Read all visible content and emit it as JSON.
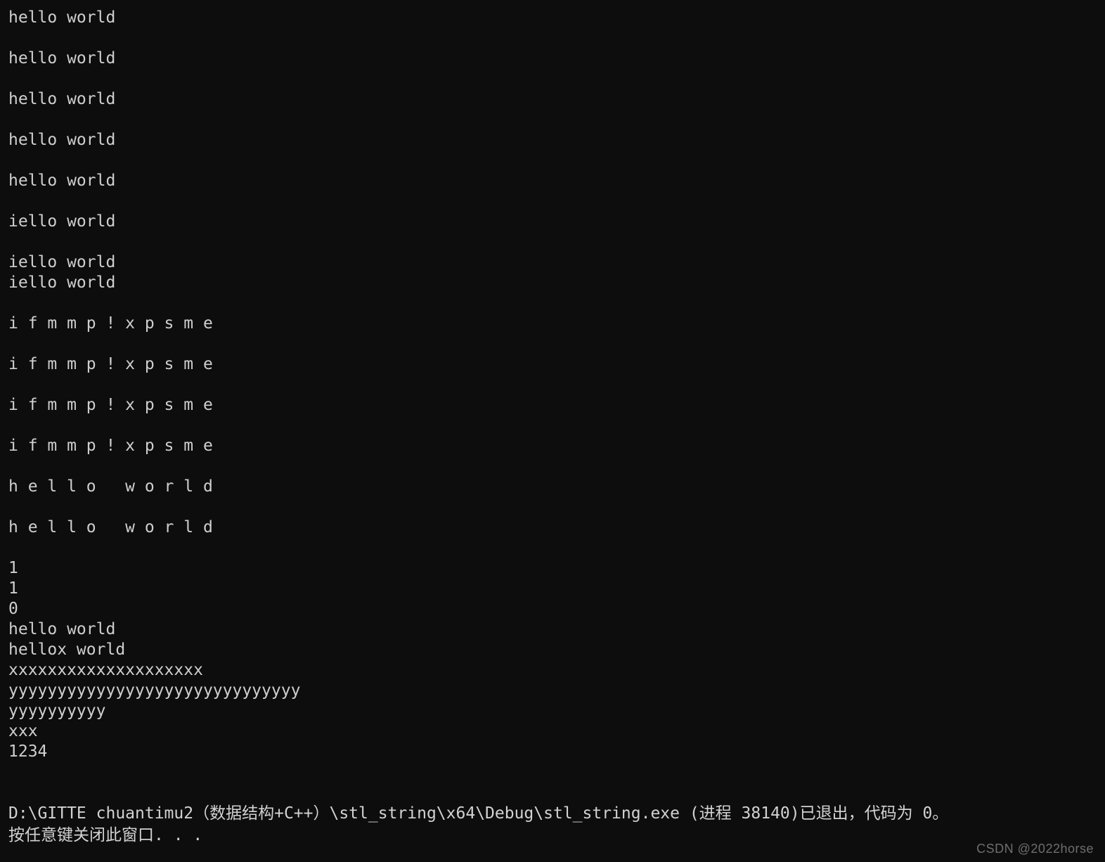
{
  "window": {
    "title": "stl_string.exe",
    "background_color": "#0d0d0d",
    "text_color": "#cfcfcf"
  },
  "console": {
    "lines": [
      "hello world",
      "",
      "hello world",
      "",
      "hello world",
      "",
      "hello world",
      "",
      "hello world",
      "",
      "iello world",
      "",
      "iello world",
      "iello world",
      "",
      "i f m m p ! x p s m e",
      "",
      "i f m m p ! x p s m e",
      "",
      "i f m m p ! x p s m e",
      "",
      "i f m m p ! x p s m e",
      "",
      "h e l l o   w o r l d",
      "",
      "h e l l o   w o r l d",
      "",
      "1",
      "1",
      "0",
      "hello world",
      "hellox world",
      "xxxxxxxxxxxxxxxxxxxx",
      "yyyyyyyyyyyyyyyyyyyyyyyyyyyyyy",
      "yyyyyyyyyy",
      "xxx",
      "1234",
      "",
      ""
    ]
  },
  "exit_message": {
    "path_line": "D:\\GITTE chuantimu2（数据结构+C++）\\stl_string\\x64\\Debug\\stl_string.exe (进程 38140)已退出，代码为 0。",
    "prompt_line": "按任意键关闭此窗口. . ."
  },
  "watermark": {
    "text": "CSDN @2022horse",
    "color": "#6e6e6e"
  }
}
